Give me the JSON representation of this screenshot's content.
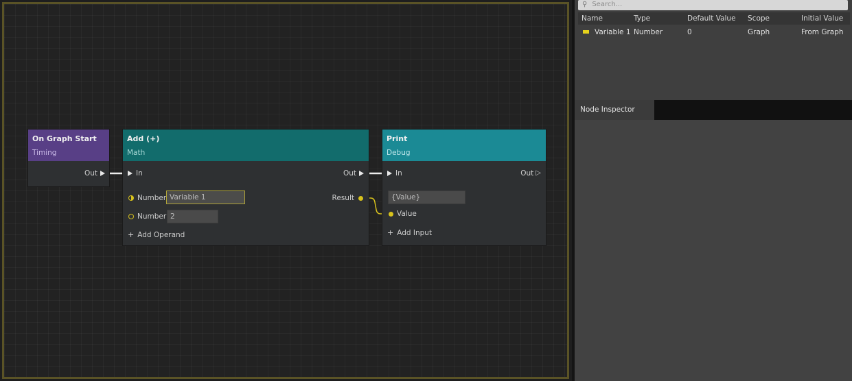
{
  "graph": {
    "nodes": {
      "on_graph_start": {
        "title": "On Graph Start",
        "category": "Timing",
        "out_label": "Out"
      },
      "add": {
        "title": "Add (+)",
        "category": "Math",
        "in_label": "In",
        "out_label": "Out",
        "result_label": "Result",
        "operands": [
          {
            "label": "Number",
            "value": "Variable 1"
          },
          {
            "label": "Number",
            "value": "2"
          }
        ],
        "add_operand_label": "Add Operand"
      },
      "print": {
        "title": "Print",
        "category": "Debug",
        "in_label": "In",
        "out_label": "Out",
        "text_value": "{Value}",
        "value_label": "Value",
        "add_input_label": "Add Input"
      }
    },
    "colors": {
      "frame": "#5a5326",
      "purple": "#583f86",
      "teal": "#126c6c",
      "cyan": "#1b8a95",
      "data_wire": "#d8c21c"
    }
  },
  "variables": {
    "search_placeholder": "Search...",
    "columns": [
      "Name",
      "Type",
      "Default Value",
      "Scope",
      "Initial Value"
    ],
    "rows": [
      {
        "name": "Variable 1",
        "type": "Number",
        "default_value": "0",
        "scope": "Graph",
        "initial_value": "From Graph",
        "color": "#e6d21c"
      }
    ]
  },
  "inspector": {
    "tab_label": "Node Inspector"
  }
}
